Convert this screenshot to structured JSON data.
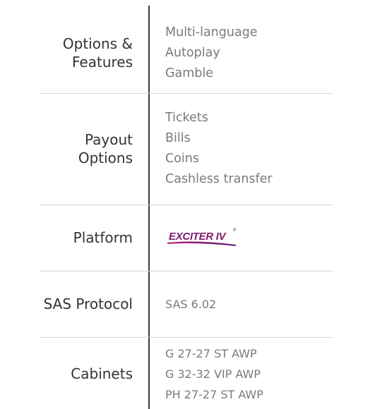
{
  "rows": [
    {
      "label_lines": [
        "Options &",
        "Features"
      ],
      "values": [
        "Multi-language",
        "Autoplay",
        "Gamble"
      ]
    },
    {
      "label_lines": [
        "Payout",
        "Options"
      ],
      "values": [
        "Tickets",
        "Bills",
        "Coins",
        "Cashless transfer"
      ]
    },
    {
      "label_lines": [
        "Platform"
      ],
      "logo_text": "EXCITER IV",
      "logo_mark": "®"
    },
    {
      "label_lines": [
        "SAS Protocol"
      ],
      "values": [
        "SAS 6.02"
      ]
    },
    {
      "label_lines": [
        "Cabinets"
      ],
      "values": [
        "G 27-27 ST AWP",
        "G 32-32 VIP AWP",
        "PH 27-27 ST AWP"
      ]
    }
  ],
  "colors": {
    "label": "#333333",
    "value": "#7a7a7a",
    "divider": "#3a3a3a",
    "separator": "#d8d8d8",
    "logo": "#8a1a6e"
  }
}
